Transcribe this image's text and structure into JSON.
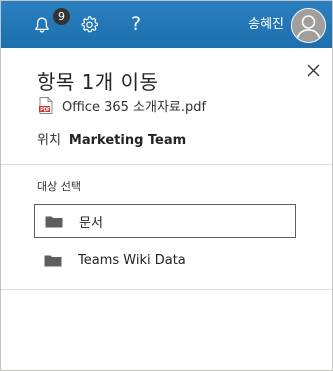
{
  "topbar": {
    "notification_count": "9",
    "help_glyph": "?",
    "user_name": "송혜진",
    "icons": [
      "bell-icon",
      "gear-icon",
      "help-icon",
      "avatar-icon"
    ],
    "color": "#1f78b4"
  },
  "panel": {
    "title": "항목 1개 이동",
    "file_name": "Office 365 소개자료.pdf",
    "location_label": "위치",
    "location_value": "Marketing Team",
    "section_label": "대상 선택",
    "destinations": [
      {
        "label": "문서",
        "selected": true,
        "icon": "folder-icon"
      },
      {
        "label": "Teams Wiki Data",
        "selected": false,
        "icon": "folder-icon"
      }
    ],
    "close_icon": "close-icon",
    "file_icon": "pdf-file-icon"
  },
  "colors": {
    "pdf_red": "#d13438",
    "folder_gray": "#605e5c",
    "selected_border": "#605e5c"
  }
}
